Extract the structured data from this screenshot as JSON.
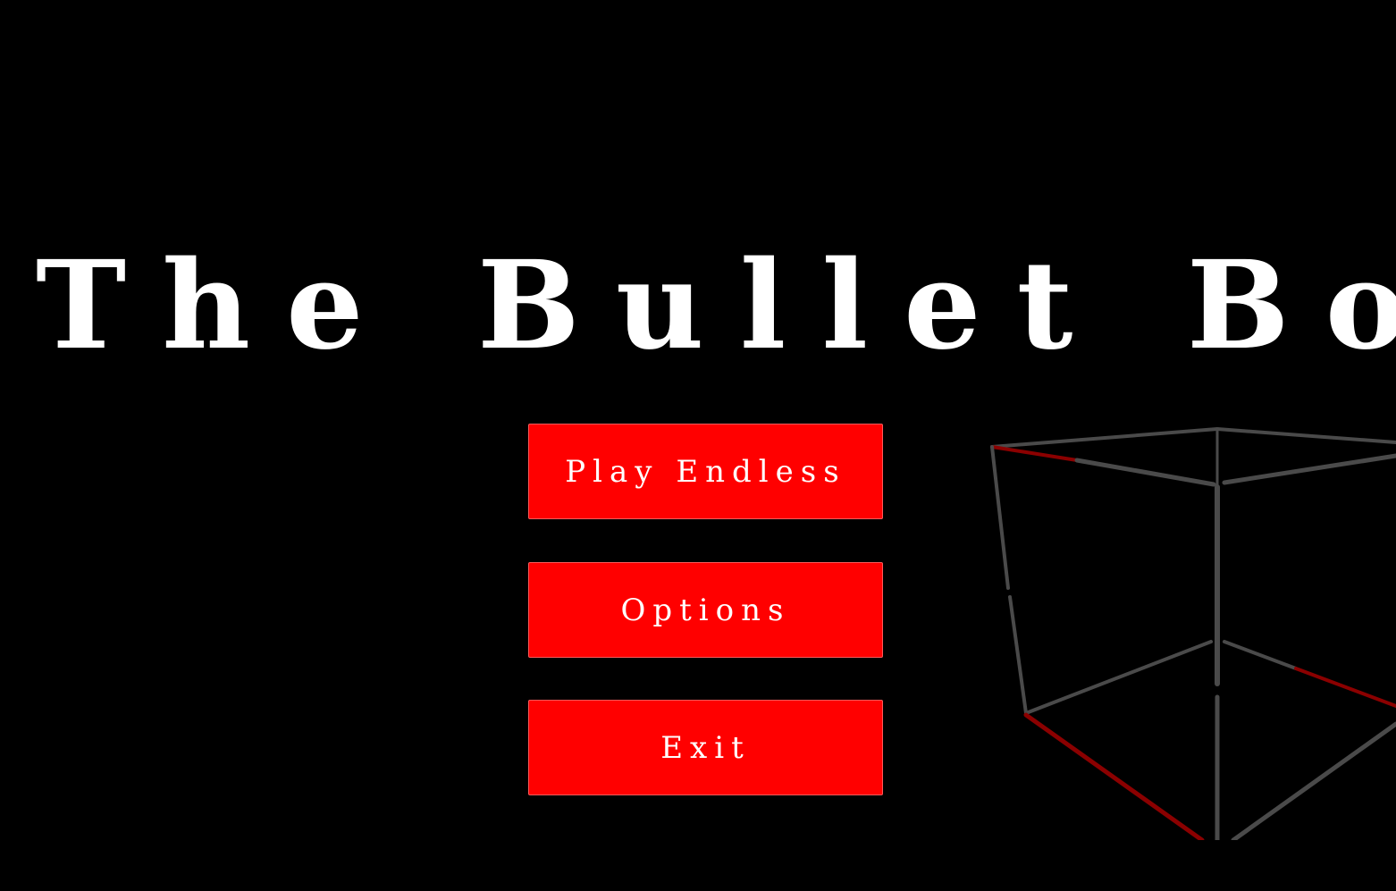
{
  "game": {
    "title": "The Bullet Box"
  },
  "menu": {
    "buttons": [
      {
        "label": "Play Endless"
      },
      {
        "label": "Options"
      },
      {
        "label": "Exit"
      }
    ]
  },
  "colors": {
    "background": "#000000",
    "button_fill": "#ff0000",
    "text": "#ffffff",
    "cube_edge": "#4a4a4a",
    "cube_accent": "#8b0000"
  },
  "decor": {
    "background_icon": "wireframe-cube-icon"
  }
}
